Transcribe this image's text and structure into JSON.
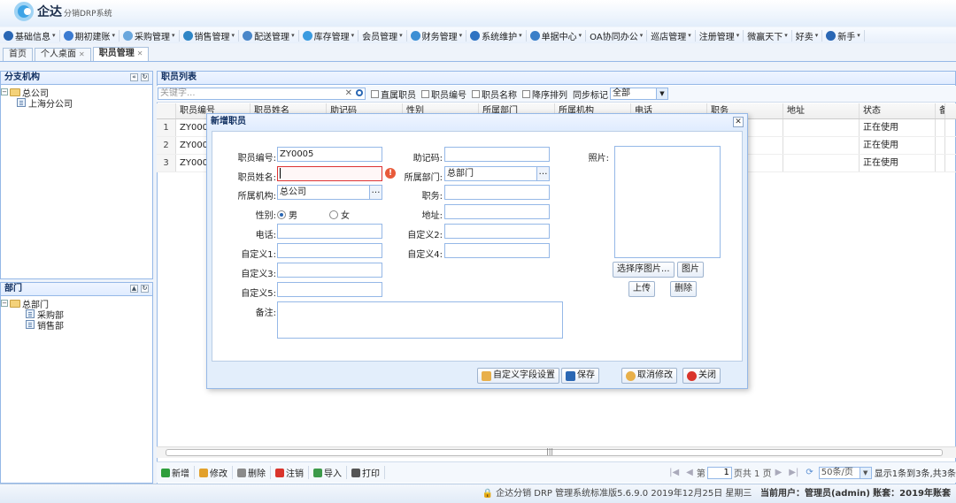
{
  "app": {
    "brand": "企达",
    "subtitle": "分销DRP系统"
  },
  "menu": [
    {
      "label": "基础信息",
      "icon": "info-icon",
      "color": "#2a67b4"
    },
    {
      "label": "期初建账",
      "icon": "ledger-icon",
      "color": "#3b7bd1"
    },
    {
      "label": "采购管理",
      "icon": "purchase-icon",
      "color": "#6aa7dd"
    },
    {
      "label": "销售管理",
      "icon": "sales-icon",
      "color": "#2f86c6"
    },
    {
      "label": "配送管理",
      "icon": "delivery-icon",
      "color": "#4a87c9"
    },
    {
      "label": "库存管理",
      "icon": "inventory-icon",
      "color": "#3a9be0"
    },
    {
      "label": "会员管理",
      "icon": "",
      "color": ""
    },
    {
      "label": "财务管理",
      "icon": "finance-icon",
      "color": "#3c8fd4"
    },
    {
      "label": "系统维护",
      "icon": "maintenance-icon",
      "color": "#2f73c2"
    },
    {
      "label": "单据中心",
      "icon": "documents-icon",
      "color": "#3a7fc8"
    },
    {
      "label": "OA协同办公",
      "icon": "",
      "color": ""
    },
    {
      "label": "巡店管理",
      "icon": "",
      "color": ""
    },
    {
      "label": "注册管理",
      "icon": "",
      "color": ""
    },
    {
      "label": "微赢天下",
      "icon": "",
      "color": ""
    },
    {
      "label": "好卖",
      "icon": "",
      "color": ""
    },
    {
      "label": "新手",
      "icon": "help-icon",
      "color": "#2a67b4"
    }
  ],
  "tabs": [
    {
      "label": "首页",
      "closable": false,
      "active": false
    },
    {
      "label": "个人桌面",
      "closable": true,
      "active": false
    },
    {
      "label": "职员管理",
      "closable": true,
      "active": true
    }
  ],
  "branch_panel": {
    "title": "分支机构",
    "root": "总公司",
    "children": [
      "上海分公司"
    ]
  },
  "dept_panel": {
    "title": "部门",
    "root": "总部门",
    "children": [
      "采购部",
      "销售部"
    ]
  },
  "staff_list": {
    "title": "职员列表",
    "search_placeholder": "关键字...",
    "filters": [
      "直属职员",
      "职员编号",
      "职员名称",
      "降序排列"
    ],
    "sync_label": "同步标记",
    "sync_value": "全部",
    "columns": [
      "职员编号",
      "职员姓名",
      "助记码",
      "性别",
      "所属部门",
      "所属机构",
      "电话",
      "职务",
      "地址",
      "状态",
      "备"
    ],
    "rows": [
      {
        "num": "1",
        "code": "ZY000",
        "status": "正在使用"
      },
      {
        "num": "2",
        "code": "ZY000",
        "status": "正在使用"
      },
      {
        "num": "3",
        "code": "ZY000",
        "status": "正在使用"
      }
    ]
  },
  "toolbar": [
    {
      "label": "新增",
      "icon": "add-icon",
      "color": "#2e9e3c"
    },
    {
      "label": "修改",
      "icon": "edit-icon",
      "color": "#e2a12c"
    },
    {
      "label": "删除",
      "icon": "delete-icon",
      "color": "#8a8a8a"
    },
    {
      "label": "注销",
      "icon": "cancel-icon",
      "color": "#d9342b"
    },
    {
      "label": "导入",
      "icon": "import-icon",
      "color": "#3d9a4a"
    },
    {
      "label": "打印",
      "icon": "print-icon",
      "color": "#555555"
    }
  ],
  "pager": {
    "page_prefix": "第",
    "page": "1",
    "page_suffix": "页共 1 页",
    "per_page": "50条/页",
    "summary": "显示1条到3条,共3条"
  },
  "status_bar": {
    "product": "企达分销 DRP 管理系统标准版5.6.9.0",
    "date": "2019年12月25日 星期三",
    "user_label": "当前用户：",
    "user": "管理员(admin)",
    "set_label": "账套：",
    "set": "2019年账套"
  },
  "modal": {
    "title": "新增职员",
    "fields": {
      "code_label": "职员编号:",
      "code_value": "ZY0005",
      "mnemonic_label": "助记码:",
      "mnemonic_value": "",
      "name_label": "职员姓名:",
      "name_value": "",
      "dept_label": "所属部门:",
      "dept_value": "总部门",
      "org_label": "所属机构:",
      "org_value": "总公司",
      "position_label": "职务:",
      "position_value": "",
      "gender_label": "性别:",
      "gender_male": "男",
      "gender_female": "女",
      "gender_selected": "男",
      "address_label": "地址:",
      "address_value": "",
      "phone_label": "电话:",
      "phone_value": "",
      "custom2_label": "自定义2:",
      "custom2_value": "",
      "custom1_label": "自定义1:",
      "custom1_value": "",
      "custom4_label": "自定义4:",
      "custom4_value": "",
      "custom3_label": "自定义3:",
      "custom3_value": "",
      "custom5_label": "自定义5:",
      "custom5_value": "",
      "notes_label": "备注:",
      "notes_value": "",
      "photo_label": "照片:"
    },
    "photo_buttons": {
      "choose": "选择序图片...",
      "image": "图片",
      "upload": "上传",
      "delete": "删除"
    },
    "footer_buttons": {
      "custom_fields": "自定义字段设置",
      "save": "保存",
      "undo": "取消修改",
      "close": "关闭"
    }
  }
}
